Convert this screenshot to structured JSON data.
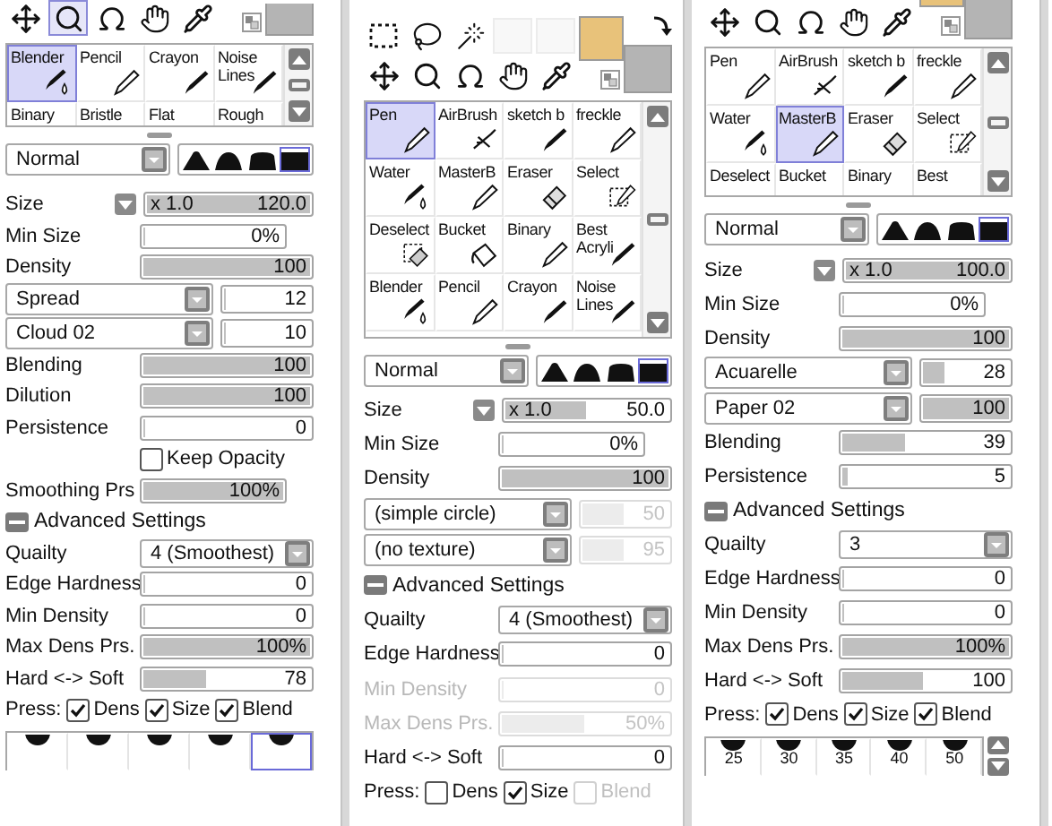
{
  "panels": [
    {
      "tool_rows": [
        [
          {
            "kind": "move",
            "selected": false
          },
          {
            "kind": "zoom",
            "selected": true
          },
          {
            "kind": "rotate",
            "selected": false
          },
          {
            "kind": "hand",
            "selected": false
          },
          {
            "kind": "eyedropper",
            "selected": false
          }
        ]
      ],
      "swatches": [
        {
          "color": "#b4b4b4"
        }
      ],
      "brushes": [
        {
          "label": "Blender",
          "kind": "water",
          "selected": true
        },
        {
          "label": "Pencil",
          "kind": "pencil",
          "selected": false
        },
        {
          "label": "Crayon",
          "kind": "marker",
          "selected": false
        },
        {
          "label": "Noise Lines",
          "kind": "marker",
          "selected": false
        },
        {
          "label": "Binary",
          "kind": "none",
          "selected": false
        },
        {
          "label": "Bristle",
          "kind": "none",
          "selected": false
        },
        {
          "label": "Flat",
          "kind": "none",
          "selected": false
        },
        {
          "label": "Rough",
          "kind": "none",
          "selected": false
        }
      ],
      "mode": "Normal",
      "shapes": [
        {
          "kind": "peak",
          "selected": false
        },
        {
          "kind": "round",
          "selected": false
        },
        {
          "kind": "flat",
          "selected": false
        },
        {
          "kind": "square",
          "selected": true
        }
      ],
      "settings": [
        {
          "kind": "size",
          "label": "Size",
          "multiplier": "x 1.0",
          "value": "120.0",
          "level": 1
        },
        {
          "kind": "short",
          "label": "Min Size",
          "value": "0%",
          "level": 0
        },
        {
          "kind": "slider",
          "label": "Density",
          "value": "100",
          "level": 1
        },
        {
          "kind": "combo",
          "option": "Spread",
          "value": "12",
          "level": 0.05
        },
        {
          "kind": "combo",
          "option": "Cloud 02",
          "value": "10",
          "level": 0.05
        },
        {
          "kind": "slider",
          "label": "Blending",
          "value": "100",
          "level": 1
        },
        {
          "kind": "slider",
          "label": "Dilution",
          "value": "100",
          "level": 1
        },
        {
          "kind": "slider",
          "label": "Persistence",
          "value": "0",
          "level": 0
        },
        {
          "kind": "checkbox",
          "label": "Keep Opacity",
          "checked": false
        },
        {
          "kind": "short",
          "label": "Smoothing Prs",
          "value": "100%",
          "level": 1
        },
        {
          "kind": "section",
          "label": "Advanced Settings",
          "expanded": true
        },
        {
          "kind": "select",
          "label": "Quailty",
          "option": "4 (Smoothest)"
        },
        {
          "kind": "slider",
          "label": "Edge Hardness",
          "value": "0",
          "level": 0
        },
        {
          "kind": "slider",
          "label": "Min Density",
          "value": "0",
          "level": 0
        },
        {
          "kind": "slider",
          "label": "Max Dens Prs.",
          "value": "100%",
          "level": 1
        },
        {
          "kind": "slider",
          "label": "Hard <-> Soft",
          "value": "78",
          "level": 0.39
        },
        {
          "kind": "press",
          "label": "Press:",
          "options": [
            {
              "label": "Dens",
              "checked": true
            },
            {
              "label": "Size",
              "checked": true
            },
            {
              "label": "Blend",
              "checked": true
            }
          ]
        }
      ],
      "sizes": [
        {
          "selected": false
        },
        {
          "selected": false
        },
        {
          "selected": false
        },
        {
          "selected": false
        },
        {
          "selected": true
        }
      ]
    },
    {
      "tool_rows": [
        [
          {
            "kind": "rect-select",
            "selected": false
          },
          {
            "kind": "lasso",
            "selected": false
          },
          {
            "kind": "wand",
            "selected": false
          },
          {
            "kind": "blank",
            "selected": false
          },
          {
            "kind": "blank",
            "selected": false
          }
        ],
        [
          {
            "kind": "move",
            "selected": false
          },
          {
            "kind": "zoom",
            "selected": false
          },
          {
            "kind": "rotate",
            "selected": false
          },
          {
            "kind": "hand",
            "selected": false
          },
          {
            "kind": "eyedropper",
            "selected": false
          }
        ]
      ],
      "swatches": [
        {
          "color": "#e8c27a"
        },
        {
          "color": "#b4b4b4"
        }
      ],
      "brushes": [
        {
          "label": "Pen",
          "kind": "pencil",
          "selected": true
        },
        {
          "label": "AirBrush",
          "kind": "airbrush",
          "selected": false
        },
        {
          "label": "sketch b",
          "kind": "marker",
          "selected": false
        },
        {
          "label": "freckle",
          "kind": "pencil",
          "selected": false
        },
        {
          "label": "Water",
          "kind": "water",
          "selected": false
        },
        {
          "label": "MasterB",
          "kind": "pencil",
          "selected": false
        },
        {
          "label": "Eraser",
          "kind": "eraser",
          "selected": false
        },
        {
          "label": "Select",
          "kind": "select",
          "selected": false
        },
        {
          "label": "Deselect",
          "kind": "deselect",
          "selected": false
        },
        {
          "label": "Bucket",
          "kind": "bucket",
          "selected": false
        },
        {
          "label": "Binary",
          "kind": "pencil",
          "selected": false
        },
        {
          "label": "Best Acryli",
          "kind": "marker",
          "selected": false
        },
        {
          "label": "Blender",
          "kind": "water",
          "selected": false
        },
        {
          "label": "Pencil",
          "kind": "pencil",
          "selected": false
        },
        {
          "label": "Crayon",
          "kind": "marker",
          "selected": false
        },
        {
          "label": "Noise Lines",
          "kind": "marker",
          "selected": false
        }
      ],
      "mode": "Normal",
      "shapes": [
        {
          "kind": "peak",
          "selected": false
        },
        {
          "kind": "round",
          "selected": false
        },
        {
          "kind": "flat",
          "selected": false
        },
        {
          "kind": "square",
          "selected": true
        }
      ],
      "settings": [
        {
          "kind": "size",
          "label": "Size",
          "multiplier": "x 1.0",
          "value": "50.0",
          "level": 0.5,
          "disabled": false
        },
        {
          "kind": "short",
          "label": "Min Size",
          "value": "0%",
          "level": 0,
          "disabled": false
        },
        {
          "kind": "slider",
          "label": "Density",
          "value": "100",
          "level": 1,
          "disabled": false
        },
        {
          "kind": "combo",
          "option": "(simple circle)",
          "value": "50",
          "level": 0.5,
          "disabled": true
        },
        {
          "kind": "combo",
          "option": "(no texture)",
          "value": "95",
          "level": 0.5,
          "disabled": true
        },
        {
          "kind": "section",
          "label": "Advanced Settings",
          "expanded": true
        },
        {
          "kind": "select",
          "label": "Quailty",
          "option": "4 (Smoothest)"
        },
        {
          "kind": "slider",
          "label": "Edge Hardness",
          "value": "0",
          "level": 0,
          "disabled": false
        },
        {
          "kind": "slider",
          "label": "Min Density",
          "value": "0",
          "level": 0,
          "disabled": true
        },
        {
          "kind": "slider",
          "label": "Max Dens Prs.",
          "value": "50%",
          "level": 0.5,
          "disabled": true
        },
        {
          "kind": "slider",
          "label": "Hard <-> Soft",
          "value": "0",
          "level": 0,
          "disabled": false
        },
        {
          "kind": "press",
          "label": "Press:",
          "options": [
            {
              "label": "Dens",
              "checked": false,
              "disabled": false
            },
            {
              "label": "Size",
              "checked": true,
              "disabled": false
            },
            {
              "label": "Blend",
              "checked": false,
              "disabled": true
            }
          ]
        }
      ]
    },
    {
      "tool_rows": [
        [
          {
            "kind": "move",
            "selected": false
          },
          {
            "kind": "zoom",
            "selected": false
          },
          {
            "kind": "rotate",
            "selected": false
          },
          {
            "kind": "hand",
            "selected": false
          },
          {
            "kind": "eyedropper",
            "selected": false
          }
        ]
      ],
      "swatches": [
        {
          "color": "#e8c27a"
        },
        {
          "color": "#b4b4b4"
        }
      ],
      "brushes": [
        {
          "label": "Pen",
          "kind": "pencil",
          "selected": false
        },
        {
          "label": "AirBrush",
          "kind": "airbrush",
          "selected": false
        },
        {
          "label": "sketch b",
          "kind": "marker",
          "selected": false
        },
        {
          "label": "freckle",
          "kind": "pencil",
          "selected": false
        },
        {
          "label": "Water",
          "kind": "water",
          "selected": false
        },
        {
          "label": "MasterB",
          "kind": "pencil",
          "selected": true
        },
        {
          "label": "Eraser",
          "kind": "eraser",
          "selected": false
        },
        {
          "label": "Select",
          "kind": "select",
          "selected": false
        },
        {
          "label": "Deselect",
          "kind": "none",
          "selected": false
        },
        {
          "label": "Bucket",
          "kind": "none",
          "selected": false
        },
        {
          "label": "Binary",
          "kind": "none",
          "selected": false
        },
        {
          "label": "Best",
          "kind": "none",
          "selected": false
        }
      ],
      "mode": "Normal",
      "shapes": [
        {
          "kind": "peak",
          "selected": false
        },
        {
          "kind": "round",
          "selected": false
        },
        {
          "kind": "flat",
          "selected": false
        },
        {
          "kind": "square",
          "selected": true
        }
      ],
      "settings": [
        {
          "kind": "size",
          "label": "Size",
          "multiplier": "x 1.0",
          "value": "100.0",
          "level": 1
        },
        {
          "kind": "short",
          "label": "Min Size",
          "value": "0%",
          "level": 0
        },
        {
          "kind": "slider",
          "label": "Density",
          "value": "100",
          "level": 1
        },
        {
          "kind": "combo",
          "option": "Acuarelle",
          "value": "28",
          "level": 0.28
        },
        {
          "kind": "combo",
          "option": "Paper 02",
          "value": "100",
          "level": 1
        },
        {
          "kind": "slider",
          "label": "Blending",
          "value": "39",
          "level": 0.39
        },
        {
          "kind": "slider",
          "label": "Persistence",
          "value": "5",
          "level": 0.05
        },
        {
          "kind": "section",
          "label": "Advanced Settings",
          "expanded": true
        },
        {
          "kind": "select",
          "label": "Quailty",
          "option": "3"
        },
        {
          "kind": "slider",
          "label": "Edge Hardness",
          "value": "0",
          "level": 0
        },
        {
          "kind": "slider",
          "label": "Min Density",
          "value": "0",
          "level": 0
        },
        {
          "kind": "slider",
          "label": "Max Dens Prs.",
          "value": "100%",
          "level": 1
        },
        {
          "kind": "slider",
          "label": "Hard <-> Soft",
          "value": "100",
          "level": 0.49
        },
        {
          "kind": "press",
          "label": "Press:",
          "options": [
            {
              "label": "Dens",
              "checked": true
            },
            {
              "label": "Size",
              "checked": true
            },
            {
              "label": "Blend",
              "checked": true
            }
          ]
        }
      ],
      "sizes": [
        {
          "label": "25",
          "selected": false
        },
        {
          "label": "30",
          "selected": false
        },
        {
          "label": "35",
          "selected": false
        },
        {
          "label": "40",
          "selected": false
        },
        {
          "label": "50",
          "selected": false
        }
      ]
    }
  ]
}
